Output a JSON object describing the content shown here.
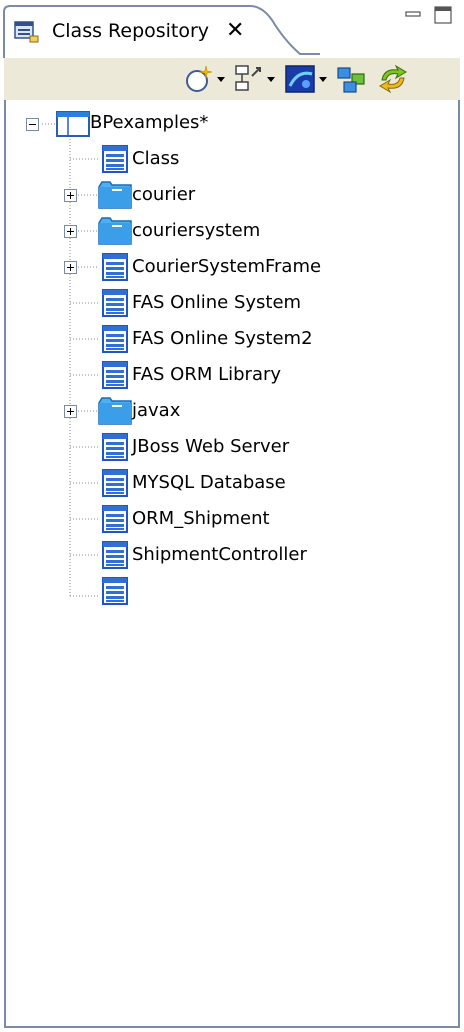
{
  "tab": {
    "title": "Class Repository",
    "close_glyph": "✕",
    "icon": "class-repository-icon"
  },
  "window_controls": {
    "minimize": "minimize-icon",
    "maximize": "maximize-icon"
  },
  "toolbar": {
    "buttons": [
      {
        "name": "new-element-icon",
        "has_dropdown": true
      },
      {
        "name": "hierarchy-icon",
        "has_dropdown": true
      },
      {
        "name": "model-icon",
        "has_dropdown": true
      },
      {
        "name": "sync-diagram-icon",
        "has_dropdown": false
      },
      {
        "name": "refresh-icon",
        "has_dropdown": false
      }
    ]
  },
  "tree": {
    "root": {
      "label": "BPexamples*",
      "expanded": true,
      "icon": "project-icon"
    },
    "items": [
      {
        "label": "Class",
        "icon": "class-icon",
        "expandable": false
      },
      {
        "label": "courier",
        "icon": "package-folder-icon",
        "expandable": true
      },
      {
        "label": "couriersystem",
        "icon": "package-folder-icon",
        "expandable": true
      },
      {
        "label": "CourierSystemFrame",
        "icon": "class-icon",
        "expandable": true
      },
      {
        "label": "FAS Online System",
        "icon": "class-icon",
        "expandable": false
      },
      {
        "label": "FAS Online System2",
        "icon": "class-icon",
        "expandable": false
      },
      {
        "label": "FAS ORM Library",
        "icon": "class-icon",
        "expandable": false
      },
      {
        "label": "javax",
        "icon": "package-folder-icon",
        "expandable": true
      },
      {
        "label": "JBoss Web Server",
        "icon": "class-icon",
        "expandable": false
      },
      {
        "label": "MYSQL Database",
        "icon": "class-icon",
        "expandable": false
      },
      {
        "label": "ORM_Shipment",
        "icon": "class-icon",
        "expandable": false
      },
      {
        "label": "ShipmentController",
        "icon": "class-icon",
        "expandable": false
      },
      {
        "label": "",
        "icon": "class-icon",
        "expandable": false
      }
    ]
  },
  "colors": {
    "tab_border": "#7a8aa8",
    "toolbar_bg": "#ece9d8",
    "class_icon_blue": "#2f6fd6",
    "folder_blue": "#3a9ee8"
  }
}
